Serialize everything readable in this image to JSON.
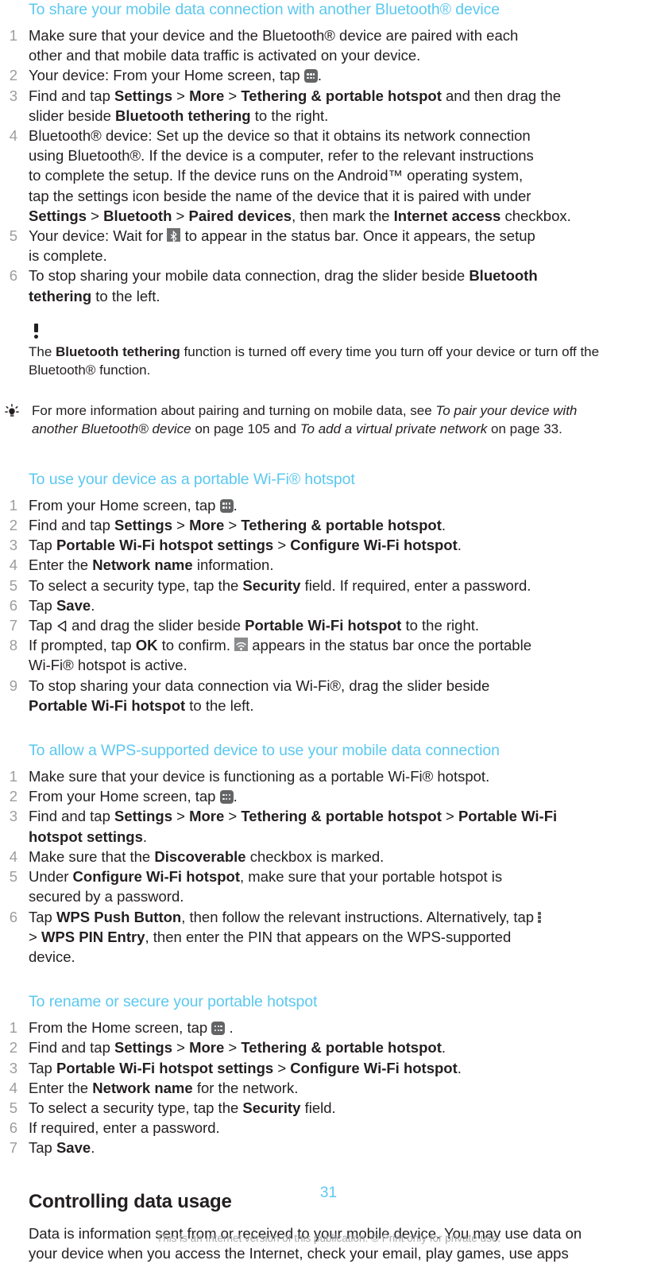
{
  "page": {
    "number": "31",
    "footer_note": "This is an Internet version of this publication. © Print only for private use."
  },
  "sections": [
    {
      "heading": "To share your mobile data connection with another Bluetooth® device",
      "steps": [
        "Make sure that your device and the Bluetooth® device are paired with each other and that mobile data traffic is activated on your device.",
        "Your device: From your Home screen, tap [app-drawer-icon].",
        "Find and tap Settings > More > Tethering & portable hotspot and then drag the slider beside Bluetooth tethering to the right.",
        "Bluetooth® device: Set up the device so that it obtains its network connection using Bluetooth®. If the device is a computer, refer to the relevant instructions to complete the setup. If the device runs on the Android™ operating system, tap the settings icon beside the name of the device that it is paired with under Settings > Bluetooth > Paired devices, then mark the Internet access checkbox.",
        "Your device: Wait for [bluetooth-status-icon] to appear in the status bar. Once it appears, the setup is complete.",
        "To stop sharing your mobile data connection, drag the slider beside Bluetooth tethering to the left."
      ]
    }
  ],
  "step1": {
    "l1": "Make sure that your device and the Bluetooth® device are paired with each",
    "l2": "other and that mobile data traffic is activated on your device."
  },
  "step2": {
    "pre": "Your device: From your Home screen, tap ",
    "post": "."
  },
  "step3": {
    "p1": "Find and tap ",
    "b1": "Settings",
    "p2": " > ",
    "b2": "More",
    "p3": " > ",
    "b3": "Tethering & portable hotspot",
    "p4": " and then drag the",
    "p5": "slider beside ",
    "b4": "Bluetooth tethering",
    "p6": " to the right."
  },
  "step4": {
    "l1": "Bluetooth® device: Set up the device so that it obtains its network connection",
    "l2": "using Bluetooth®. If the device is a computer, refer to the relevant instructions",
    "l3": "to complete the setup. If the device runs on the Android™ operating system,",
    "l4": "tap the settings icon beside the name of the device that it is paired with under",
    "b1": "Settings",
    "sep1": " > ",
    "b2": "Bluetooth",
    "sep2": " > ",
    "b3": "Paired devices",
    "mid": ", then mark the ",
    "b4": "Internet access",
    "end": " checkbox."
  },
  "step5": {
    "pre": "Your device: Wait for ",
    "post": " to appear in the status bar. Once it appears, the setup",
    "l2": "is complete."
  },
  "step6": {
    "pre": "To stop sharing your mobile data connection, drag the slider beside ",
    "b1": "Bluetooth",
    "b2": "tethering",
    "post": " to the left."
  },
  "note_bt": {
    "pre": "The ",
    "bold": "Bluetooth tethering",
    "post": " function is turned off every time you turn off your device or turn off the",
    "l2": "Bluetooth® function."
  },
  "tip_bt": {
    "pre": "For more information about pairing and turning on mobile data, see ",
    "i1": "To pair your device with",
    "i2": "another Bluetooth® device",
    "mid": " on page 105 and ",
    "i3": "To add a virtual private network",
    "post": " on page 33."
  },
  "wifi_section": {
    "heading": "To use your device as a portable Wi-Fi® hotspot",
    "s1_pre": "From your Home screen, tap ",
    "s1_post": ".",
    "s2_pre": "Find and tap ",
    "s2_b1": "Settings",
    "s2_sep1": " > ",
    "s2_b2": "More",
    "s2_sep2": " > ",
    "s2_b3": "Tethering & portable hotspot",
    "s2_post": ".",
    "s3_pre": "Tap ",
    "s3_b1": "Portable Wi-Fi hotspot settings",
    "s3_sep": " > ",
    "s3_b2": "Configure Wi-Fi hotspot",
    "s3_post": ".",
    "s4_pre": "Enter the ",
    "s4_b1": "Network name",
    "s4_post": " information.",
    "s5_pre": "To select a security type, tap the ",
    "s5_b1": "Security",
    "s5_post": " field. If required, enter a password.",
    "s6_pre": "Tap ",
    "s6_b1": "Save",
    "s6_post": ".",
    "s7_pre": "Tap ",
    "s7_mid": " and drag the slider beside ",
    "s7_b1": "Portable Wi-Fi hotspot",
    "s7_post": " to the right.",
    "s8_pre": "If prompted, tap ",
    "s8_b1": "OK",
    "s8_mid": " to confirm. ",
    "s8_post": " appears in the status bar once the portable",
    "s8_l2": "Wi-Fi® hotspot is active.",
    "s9_pre": "To stop sharing your data connection via Wi-Fi®, drag the slider beside",
    "s9_b1": "Portable Wi-Fi hotspot",
    "s9_post": " to the left."
  },
  "wps_section": {
    "heading": "To allow a WPS-supported device to use your mobile data connection",
    "s1": "Make sure that your device is functioning as a portable Wi-Fi® hotspot.",
    "s2_pre": "From your Home screen, tap ",
    "s2_post": ".",
    "s3_pre": "Find and tap ",
    "s3_b1": "Settings",
    "s3_sep1": " > ",
    "s3_b2": "More",
    "s3_sep2": " > ",
    "s3_b3": "Tethering & portable hotspot",
    "s3_sep3": " > ",
    "s3_b4": "Portable Wi-Fi",
    "s3_b5": "hotspot settings",
    "s3_post": ".",
    "s4_pre": "Make sure that the ",
    "s4_b1": "Discoverable",
    "s4_post": " checkbox is marked.",
    "s5_pre": "Under ",
    "s5_b1": "Configure Wi-Fi hotspot",
    "s5_post": ", make sure that your portable hotspot is",
    "s5_l2": "secured by a password.",
    "s6_pre": "Tap ",
    "s6_b1": "WPS Push Button",
    "s6_post": ", then follow the relevant instructions. Alternatively, tap ",
    "s6_l2_pre": "> ",
    "s6_b2": "WPS PIN Entry",
    "s6_l2_post": ", then enter the PIN that appears on the WPS-supported",
    "s6_l3": "device."
  },
  "rename_section": {
    "heading": "To rename or secure your portable hotspot",
    "s1_pre": "From the Home screen, tap ",
    "s1_post": " .",
    "s2_pre": "Find and tap ",
    "s2_b1": "Settings",
    "s2_sep1": " > ",
    "s2_b2": "More",
    "s2_sep2": " > ",
    "s2_b3": "Tethering & portable hotspot",
    "s2_post": ".",
    "s3_pre": "Tap ",
    "s3_b1": "Portable Wi-Fi hotspot settings",
    "s3_sep": " > ",
    "s3_b2": "Configure Wi-Fi hotspot",
    "s3_post": ".",
    "s4_pre": "Enter the ",
    "s4_b1": "Network name",
    "s4_post": " for the network.",
    "s5_pre": "To select a security type, tap the ",
    "s5_b1": "Security",
    "s5_post": " field.",
    "s6": "If required, enter a password.",
    "s7_pre": "Tap ",
    "s7_b1": "Save",
    "s7_post": "."
  },
  "data_usage": {
    "heading": "Controlling data usage",
    "l1": "Data is information sent from or received to your mobile device. You may use data on",
    "l2": "your device when you access the Internet, check your email, play games, use apps"
  },
  "colors": {
    "heading_blue": "#5bc8f0",
    "body_black": "#231f20",
    "step_number_gray": "#9d9d9d",
    "footer_gray": "#a7a9ac",
    "icon_gray": "#636466"
  },
  "icons": {
    "app_drawer": "app-drawer-icon",
    "bluetooth_status": "bluetooth-status-icon",
    "wifi_hotspot_status": "wifi-hotspot-status-icon",
    "back": "back-arrow-icon",
    "overflow_menu": "kebab-menu-icon",
    "note": "exclamation-icon",
    "tip": "lightbulb-icon"
  }
}
